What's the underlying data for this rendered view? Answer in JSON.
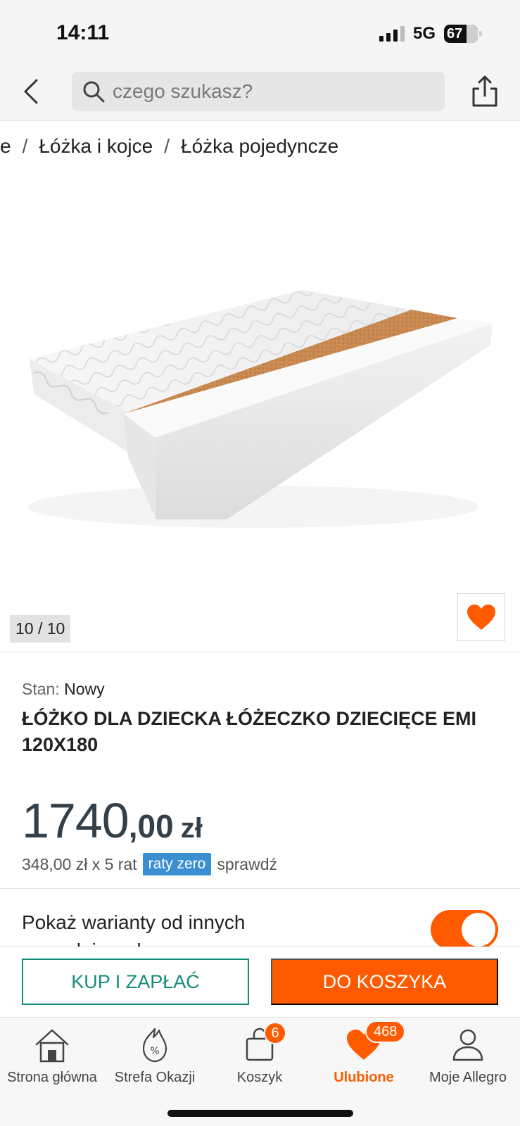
{
  "status_bar": {
    "time": "14:11",
    "network": "5G",
    "battery": "67"
  },
  "header": {
    "search_placeholder": "czego szukasz?"
  },
  "breadcrumb": [
    "e",
    "Łóżka i kojce",
    "Łóżka pojedyncze"
  ],
  "gallery": {
    "counter": "10 / 10"
  },
  "product": {
    "condition_label": "Stan:",
    "condition_value": "Nowy",
    "title": "ŁÓŻKO DLA DZIECKA ŁÓŻECZKO DZIECIĘCE EMI 120X180",
    "price_int": "1740",
    "price_dec": ",00",
    "currency": "zł",
    "installment_text": "348,00 zł x 5 rat",
    "installment_badge": "raty zero",
    "installment_link": "sprawdź"
  },
  "variants": {
    "label": "Pokaż warianty od innych sprzedających",
    "toggle_on": true
  },
  "actions": {
    "buy_now": "KUP I ZAPŁAĆ",
    "add_to_cart": "DO KOSZYKA"
  },
  "bottom_nav": {
    "items": [
      {
        "label": "Strona główna",
        "icon": "home-icon"
      },
      {
        "label": "Strefa Okazji",
        "icon": "deals-icon"
      },
      {
        "label": "Koszyk",
        "icon": "cart-icon",
        "badge": "6"
      },
      {
        "label": "Ulubione",
        "icon": "heart-icon",
        "badge": "468",
        "active": true
      },
      {
        "label": "Moje Allegro",
        "icon": "user-icon"
      }
    ]
  },
  "colors": {
    "accent": "#ff5a00",
    "buy_green": "#138c7a",
    "raty_blue": "#3a8fd0",
    "price": "#33404a"
  }
}
